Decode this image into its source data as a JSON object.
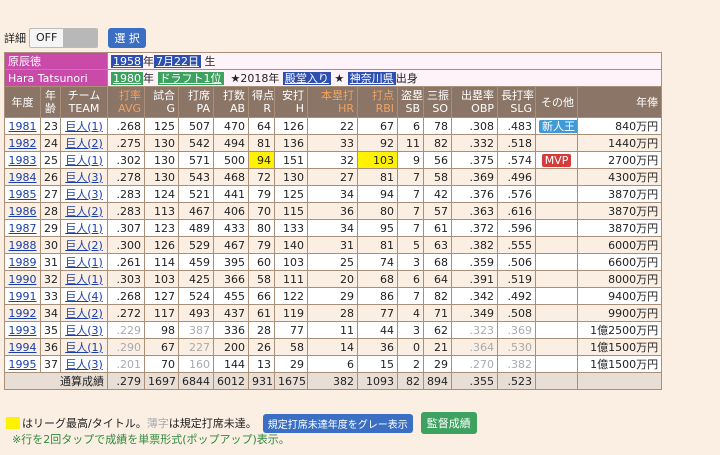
{
  "topbar": {
    "detail_label": "詳細",
    "toggle_state": "OFF",
    "select_button": "選 択"
  },
  "profile": {
    "name_jp": "原辰徳",
    "name_en": "Hara Tatsunori",
    "birth_year": "1958",
    "year_suffix": "年",
    "birth_date": "7月22日",
    "birth_suffix": "生",
    "draft_year": "1980",
    "draft": "ドラフト1位",
    "honor_prefix": "★2018年",
    "hof": "殿堂入り",
    "star2": "★",
    "pref": "神奈川県",
    "origin": "出身"
  },
  "headers": [
    {
      "l1": "年度",
      "l2": ""
    },
    {
      "l1": "年",
      "l2": "齢"
    },
    {
      "l1": "チーム",
      "l2": "TEAM"
    },
    {
      "l1": "打率",
      "l2": "AVG",
      "orange": true
    },
    {
      "l1": "試合",
      "l2": "G"
    },
    {
      "l1": "打席",
      "l2": "PA"
    },
    {
      "l1": "打数",
      "l2": "AB"
    },
    {
      "l1": "得点",
      "l2": "R"
    },
    {
      "l1": "安打",
      "l2": "H"
    },
    {
      "l1": "本塁打",
      "l2": "HR",
      "orange": true
    },
    {
      "l1": "打点",
      "l2": "RBI",
      "orange": true
    },
    {
      "l1": "盗塁",
      "l2": "SB"
    },
    {
      "l1": "三振",
      "l2": "SO"
    },
    {
      "l1": "出塁率",
      "l2": "OBP"
    },
    {
      "l1": "長打率",
      "l2": "SLG"
    },
    {
      "l1": "その他",
      "l2": ""
    },
    {
      "l1": "年俸",
      "l2": ""
    }
  ],
  "rows": [
    {
      "year": "1981",
      "age": "23",
      "team": "巨人(1)",
      "avg": ".268",
      "g": "125",
      "pa": "507",
      "ab": "470",
      "r": "64",
      "h": "126",
      "hr": "22",
      "rbi": "67",
      "sb": "6",
      "so": "78",
      "obp": ".308",
      "slg": ".483",
      "other": "新人王",
      "salary": "840万円"
    },
    {
      "year": "1982",
      "age": "24",
      "team": "巨人(2)",
      "avg": ".275",
      "g": "130",
      "pa": "542",
      "ab": "494",
      "r": "81",
      "h": "136",
      "hr": "33",
      "rbi": "92",
      "sb": "11",
      "so": "82",
      "obp": ".332",
      "slg": ".518",
      "other": "",
      "salary": "1440万円"
    },
    {
      "year": "1983",
      "age": "25",
      "team": "巨人(1)",
      "avg": ".302",
      "g": "130",
      "pa": "571",
      "ab": "500",
      "r": "94",
      "h": "151",
      "hr": "32",
      "rbi": "103",
      "sb": "9",
      "so": "56",
      "obp": ".375",
      "slg": ".574",
      "other": "MVP",
      "salary": "2700万円"
    },
    {
      "year": "1984",
      "age": "26",
      "team": "巨人(3)",
      "avg": ".278",
      "g": "130",
      "pa": "543",
      "ab": "468",
      "r": "72",
      "h": "130",
      "hr": "27",
      "rbi": "81",
      "sb": "7",
      "so": "58",
      "obp": ".369",
      "slg": ".496",
      "other": "",
      "salary": "4300万円"
    },
    {
      "year": "1985",
      "age": "27",
      "team": "巨人(3)",
      "avg": ".283",
      "g": "124",
      "pa": "521",
      "ab": "441",
      "r": "79",
      "h": "125",
      "hr": "34",
      "rbi": "94",
      "sb": "7",
      "so": "42",
      "obp": ".376",
      "slg": ".576",
      "other": "",
      "salary": "3870万円"
    },
    {
      "year": "1986",
      "age": "28",
      "team": "巨人(2)",
      "avg": ".283",
      "g": "113",
      "pa": "467",
      "ab": "406",
      "r": "70",
      "h": "115",
      "hr": "36",
      "rbi": "80",
      "sb": "7",
      "so": "57",
      "obp": ".363",
      "slg": ".616",
      "other": "",
      "salary": "3870万円"
    },
    {
      "year": "1987",
      "age": "29",
      "team": "巨人(1)",
      "avg": ".307",
      "g": "123",
      "pa": "489",
      "ab": "433",
      "r": "80",
      "h": "133",
      "hr": "34",
      "rbi": "95",
      "sb": "7",
      "so": "61",
      "obp": ".372",
      "slg": ".596",
      "other": "",
      "salary": "3870万円"
    },
    {
      "year": "1988",
      "age": "30",
      "team": "巨人(2)",
      "avg": ".300",
      "g": "126",
      "pa": "529",
      "ab": "467",
      "r": "79",
      "h": "140",
      "hr": "31",
      "rbi": "81",
      "sb": "5",
      "so": "63",
      "obp": ".382",
      "slg": ".555",
      "other": "",
      "salary": "6000万円"
    },
    {
      "year": "1989",
      "age": "31",
      "team": "巨人(1)",
      "avg": ".261",
      "g": "114",
      "pa": "459",
      "ab": "395",
      "r": "60",
      "h": "103",
      "hr": "25",
      "rbi": "74",
      "sb": "3",
      "so": "68",
      "obp": ".359",
      "slg": ".506",
      "other": "",
      "salary": "6600万円"
    },
    {
      "year": "1990",
      "age": "32",
      "team": "巨人(1)",
      "avg": ".303",
      "g": "103",
      "pa": "425",
      "ab": "366",
      "r": "58",
      "h": "111",
      "hr": "20",
      "rbi": "68",
      "sb": "6",
      "so": "64",
      "obp": ".391",
      "slg": ".519",
      "other": "",
      "salary": "8000万円"
    },
    {
      "year": "1991",
      "age": "33",
      "team": "巨人(4)",
      "avg": ".268",
      "g": "127",
      "pa": "524",
      "ab": "455",
      "r": "66",
      "h": "122",
      "hr": "29",
      "rbi": "86",
      "sb": "7",
      "so": "82",
      "obp": ".342",
      "slg": ".492",
      "other": "",
      "salary": "9400万円"
    },
    {
      "year": "1992",
      "age": "34",
      "team": "巨人(2)",
      "avg": ".272",
      "g": "117",
      "pa": "493",
      "ab": "437",
      "r": "61",
      "h": "119",
      "hr": "28",
      "rbi": "77",
      "sb": "4",
      "so": "71",
      "obp": ".349",
      "slg": ".508",
      "other": "",
      "salary": "9900万円"
    },
    {
      "year": "1993",
      "age": "35",
      "team": "巨人(3)",
      "avg": ".229",
      "g": "98",
      "pa": "387",
      "ab": "336",
      "r": "28",
      "h": "77",
      "hr": "11",
      "rbi": "44",
      "sb": "3",
      "so": "62",
      "obp": ".323",
      "slg": ".369",
      "other": "",
      "salary": "1億2500万円",
      "greyed": true
    },
    {
      "year": "1994",
      "age": "36",
      "team": "巨人(1)",
      "avg": ".290",
      "g": "67",
      "pa": "227",
      "ab": "200",
      "r": "26",
      "h": "58",
      "hr": "14",
      "rbi": "36",
      "sb": "0",
      "so": "21",
      "obp": ".364",
      "slg": ".530",
      "other": "",
      "salary": "1億1500万円",
      "greyed": true
    },
    {
      "year": "1995",
      "age": "37",
      "team": "巨人(3)",
      "avg": ".201",
      "g": "70",
      "pa": "160",
      "ab": "144",
      "r": "13",
      "h": "29",
      "hr": "6",
      "rbi": "15",
      "sb": "2",
      "so": "29",
      "obp": ".270",
      "slg": ".382",
      "other": "",
      "salary": "1億1500万円",
      "greyed": true
    }
  ],
  "total": {
    "label": "通算成績",
    "avg": ".279",
    "g": "1697",
    "pa": "6844",
    "ab": "6012",
    "r": "931",
    "h": "1675",
    "hr": "382",
    "rbi": "1093",
    "sb": "82",
    "so": "894",
    "obp": ".355",
    "slg": ".523"
  },
  "legend": {
    "part1": "はリーグ最高/タイトル。",
    "grey_word": "薄字",
    "part2": "は規定打席未達。",
    "grey_toggle": "規定打席未達年度をグレー表示",
    "manager_button": "監督成績"
  },
  "note": "※行を2回タップで成績を単票形式(ポップアップ)表示。"
}
